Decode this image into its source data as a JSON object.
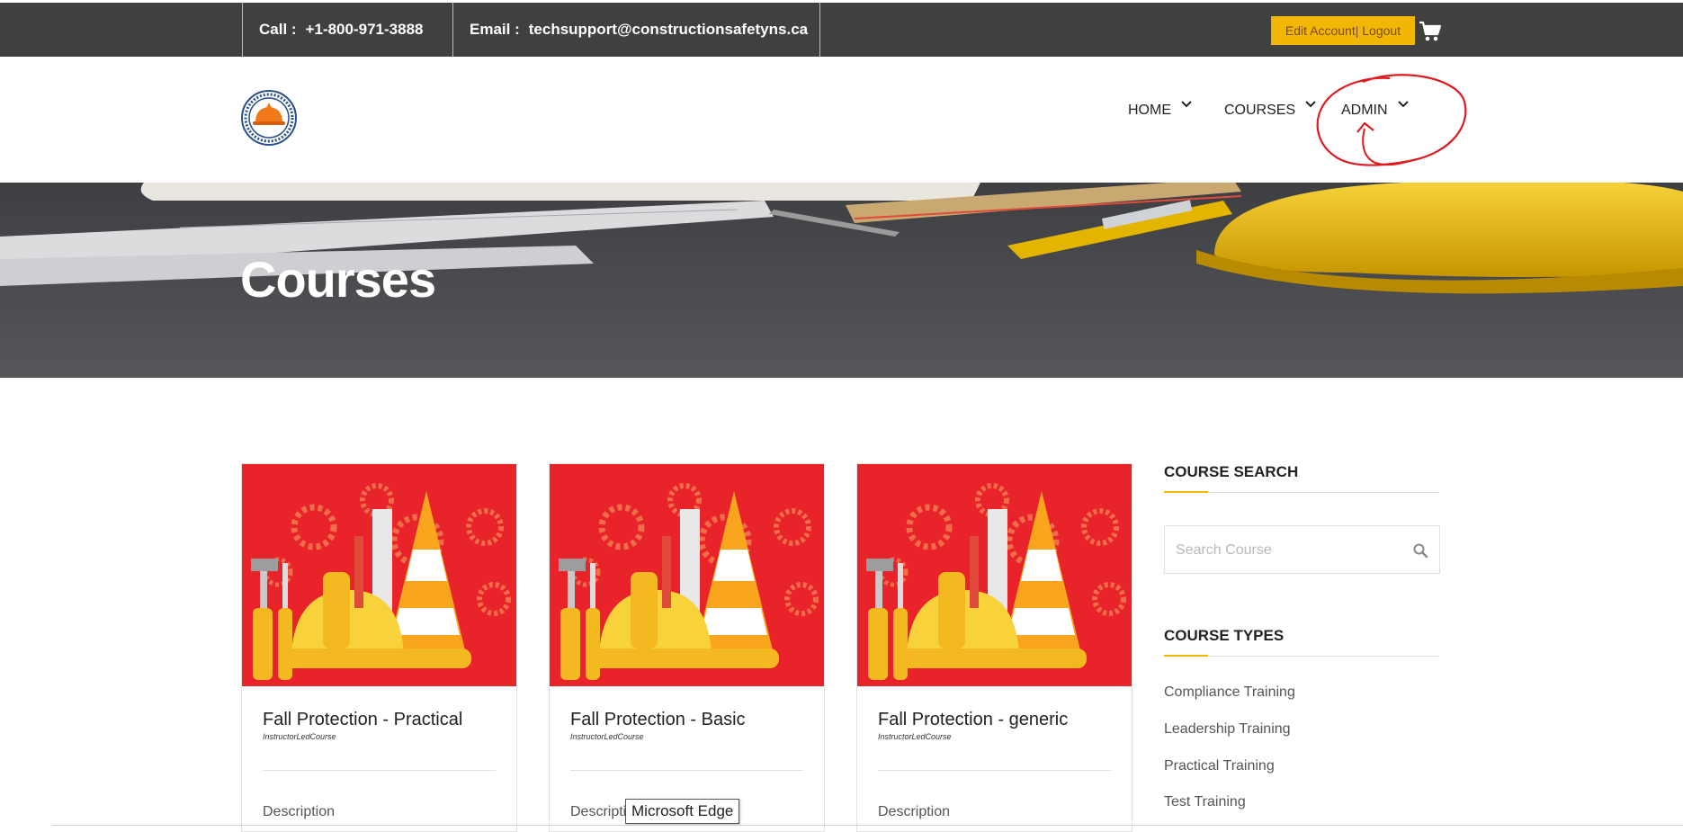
{
  "topbar": {
    "call_label": "Call :",
    "call_value": "+1-800-971-3888",
    "email_label": "Email :",
    "email_value": "techsupport@constructionsafetyns.ca",
    "account_button": "Edit Account| Logout",
    "cart_icon": "shopping-cart-icon",
    "bar_color": "#404040",
    "accent_color": "#f2b705"
  },
  "header": {
    "logo_icon": "construction-safety-logo",
    "nav": [
      {
        "label": "HOME",
        "icon": "chevron-down-icon"
      },
      {
        "label": "COURSES",
        "icon": "chevron-down-icon"
      },
      {
        "label": "ADMIN",
        "icon": "chevron-down-icon"
      }
    ],
    "annotation_color": "#e0191e"
  },
  "hero": {
    "title": "Courses"
  },
  "courses": [
    {
      "title": "Fall Protection - Practical",
      "type": "InstructorLedCourse",
      "description": "Description"
    },
    {
      "title": "Fall Protection - Basic",
      "type": "InstructorLedCourse",
      "description": "Description"
    },
    {
      "title": "Fall Protection - generic",
      "type": "InstructorLedCourse",
      "description": "Description"
    }
  ],
  "sidebar": {
    "search_heading": "COURSE SEARCH",
    "search_placeholder": "Search Course",
    "search_icon": "search-icon",
    "types_heading": "COURSE TYPES",
    "types": [
      "Compliance Training",
      "Leadership Training",
      "Practical Training",
      "Test Training"
    ]
  },
  "tooltip": {
    "text": "Microsoft Edge"
  }
}
